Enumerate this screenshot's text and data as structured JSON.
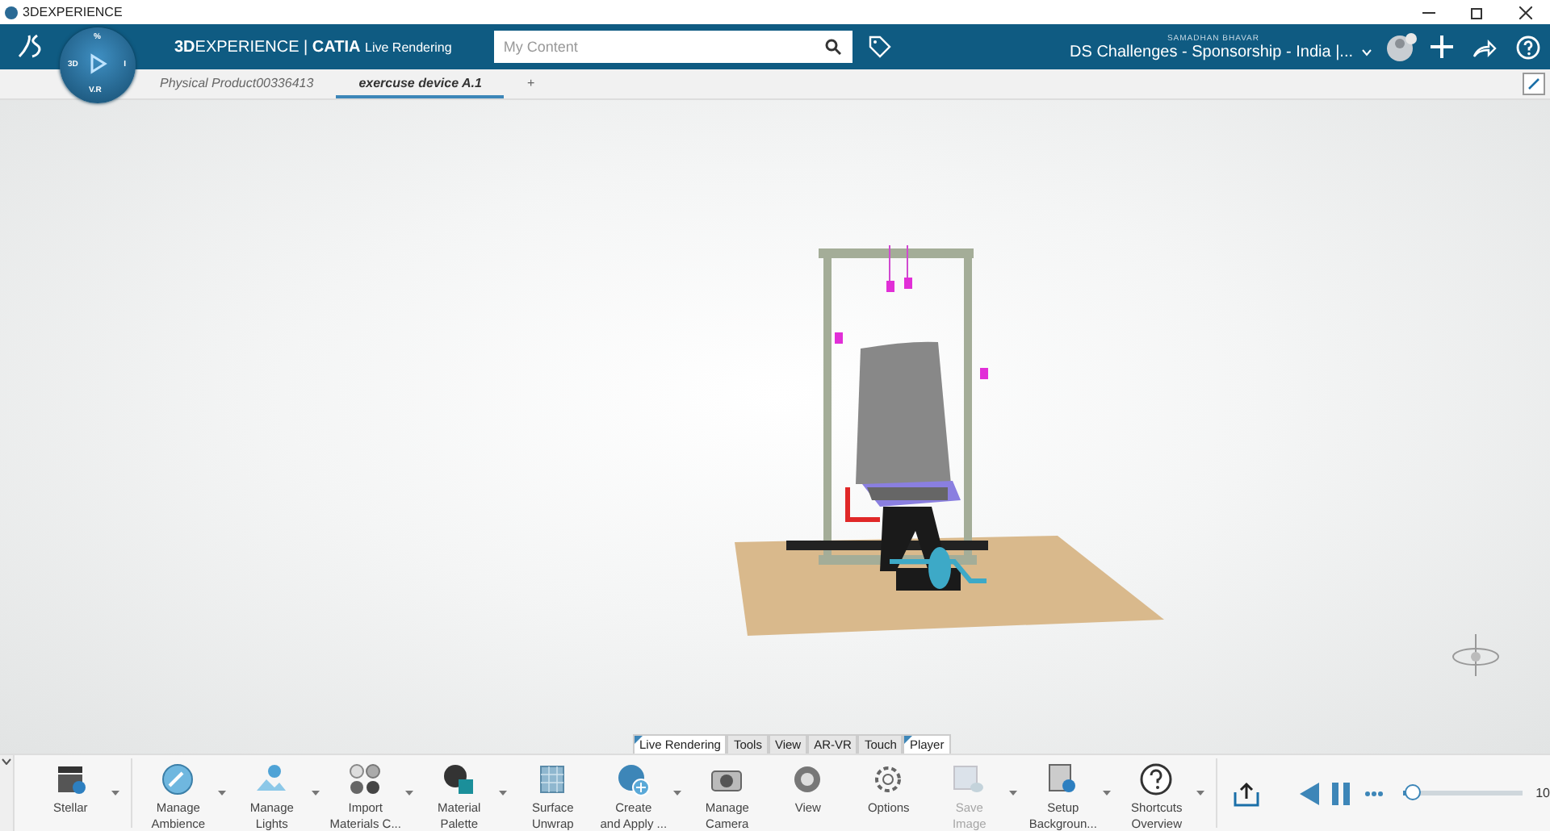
{
  "window": {
    "title": "3DEXPERIENCE"
  },
  "top_bar": {
    "brand_bold": "3D",
    "brand_rest": "EXPERIENCE | ",
    "app": "CATIA",
    "app_role": "Live Rendering",
    "search": {
      "placeholder": "My Content"
    },
    "user": "SAMADHAN BHAVAR",
    "space": "DS Challenges - Sponsorship - India |..."
  },
  "compass": {
    "top": "%",
    "left": "3D",
    "right": "I",
    "bottom": "V.R"
  },
  "doc_tabs": [
    {
      "label": "Physical Product00336413",
      "selected": false
    },
    {
      "label": "exercuse device A.1",
      "selected": true
    },
    {
      "label": "+",
      "selected": false
    }
  ],
  "workbench_tabs": [
    {
      "label": "Live Rendering",
      "selected": true
    },
    {
      "label": "Tools",
      "selected": false
    },
    {
      "label": "View",
      "selected": false
    },
    {
      "label": "AR-VR",
      "selected": false
    },
    {
      "label": "Touch",
      "selected": false
    },
    {
      "label": "Player",
      "selected": true
    }
  ],
  "toolbar": [
    {
      "label": "Stellar",
      "dropdown": true,
      "disabled": false
    },
    {
      "label": "Manage\nAmbience",
      "dropdown": true,
      "disabled": false
    },
    {
      "label": "Manage\nLights",
      "dropdown": true,
      "disabled": false
    },
    {
      "label": "Import\nMaterials C...",
      "dropdown": true,
      "disabled": false
    },
    {
      "label": "Material\nPalette",
      "dropdown": true,
      "disabled": false
    },
    {
      "label": "Surface\nUnwrap",
      "dropdown": false,
      "disabled": false
    },
    {
      "label": "Create\nand Apply ...",
      "dropdown": true,
      "disabled": false
    },
    {
      "label": "Manage\nCamera",
      "dropdown": false,
      "disabled": false
    },
    {
      "label": "View",
      "dropdown": false,
      "disabled": false
    },
    {
      "label": "Options",
      "dropdown": false,
      "disabled": false
    },
    {
      "label": "Save\nImage",
      "dropdown": true,
      "disabled": true
    },
    {
      "label": "Setup\nBackgroun...",
      "dropdown": true,
      "disabled": false
    },
    {
      "label": "Shortcuts\nOverview",
      "dropdown": true,
      "disabled": false
    }
  ],
  "player": {
    "level": 0.08,
    "value": "10"
  }
}
